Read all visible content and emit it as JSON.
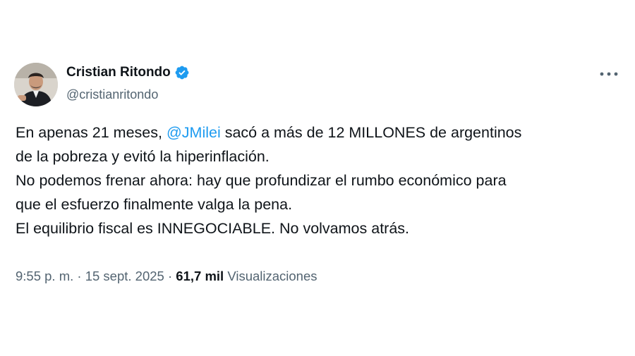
{
  "author": {
    "display_name": "Cristian Ritondo",
    "handle": "@cristianritondo",
    "verified_icon": "verified-badge-icon",
    "avatar_icon": "profile-photo"
  },
  "tweet": {
    "line1_before": "En apenas 21 meses, ",
    "mention": "@JMilei",
    "line1_after": " sacó a más de 12 MILLONES de argentinos",
    "line2": "de la pobreza y evitó la hiperinflación.",
    "line3": "No podemos frenar ahora: hay que profundizar el rumbo económico para",
    "line4": "que el esfuerzo finalmente valga la pena.",
    "line5": "El equilibrio fiscal es INNEGOCIABLE. No volvamos atrás."
  },
  "meta": {
    "time": "9:55 p. m.",
    "separator1": " · ",
    "date": "15 sept. 2025",
    "separator2": " · ",
    "views_count": "61,7 mil",
    "views_label": " Visualizaciones"
  },
  "colors": {
    "text": "#0f1419",
    "secondary": "#536471",
    "accent": "#1d9bf0"
  }
}
